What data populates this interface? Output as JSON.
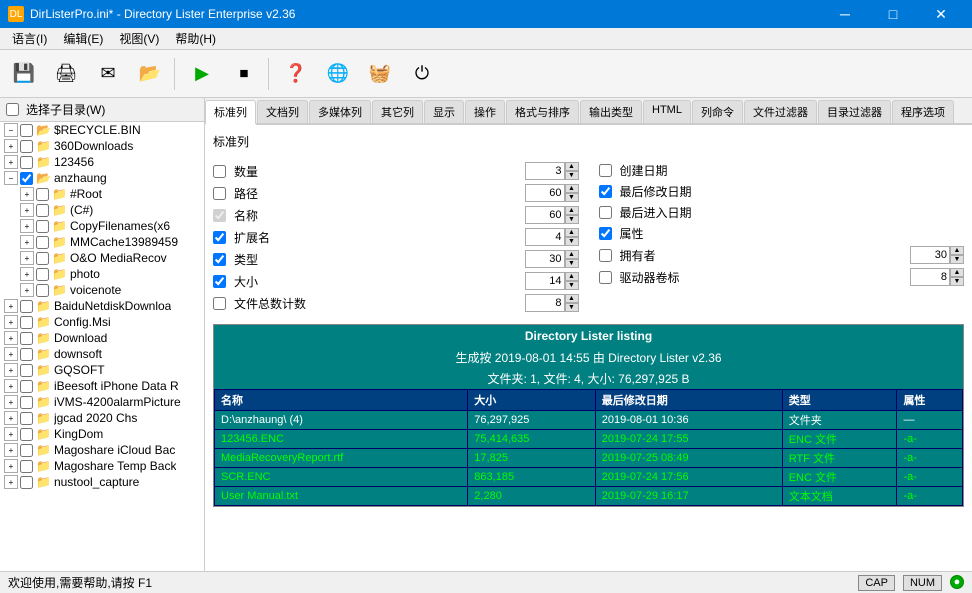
{
  "titleBar": {
    "title": "DirListerPro.ini* - Directory Lister Enterprise v2.36",
    "icon": "DL",
    "minBtn": "─",
    "maxBtn": "□",
    "closeBtn": "✕"
  },
  "menuBar": {
    "items": [
      "语言(I)",
      "编辑(E)",
      "视图(V)",
      "帮助(H)"
    ]
  },
  "toolbar": {
    "buttons": [
      "💾",
      "🖨",
      "✉",
      "📂",
      "▶",
      "⏹",
      "❓",
      "🌐",
      "🧺",
      "⏻"
    ]
  },
  "leftPanel": {
    "header": "选择子目录(W)",
    "treeItems": [
      {
        "id": "recycle",
        "label": "$RECYCLE.BIN",
        "level": 1,
        "expanded": true,
        "checked": false
      },
      {
        "id": "360downloads",
        "label": "360Downloads",
        "level": 1,
        "expanded": false,
        "checked": false
      },
      {
        "id": "123456",
        "label": "123456",
        "level": 1,
        "expanded": false,
        "checked": false
      },
      {
        "id": "anzhaung",
        "label": "anzhaung",
        "level": 1,
        "expanded": true,
        "checked": true
      },
      {
        "id": "root",
        "label": "#Root",
        "level": 2,
        "expanded": false,
        "checked": false
      },
      {
        "id": "csharp",
        "label": "(C#)",
        "level": 2,
        "expanded": false,
        "checked": false
      },
      {
        "id": "copyfilenames",
        "label": "CopyFilenames(x6",
        "level": 2,
        "expanded": false,
        "checked": false
      },
      {
        "id": "mmcache",
        "label": "MMCache13989459",
        "level": 2,
        "expanded": false,
        "checked": false
      },
      {
        "id": "oomedia",
        "label": "O&O MediaRecov",
        "level": 2,
        "expanded": false,
        "checked": false
      },
      {
        "id": "photo",
        "label": "photo",
        "level": 2,
        "expanded": false,
        "checked": false
      },
      {
        "id": "voicenote",
        "label": "voicenote",
        "level": 2,
        "expanded": false,
        "checked": false
      },
      {
        "id": "baidunetdisk",
        "label": "BaiduNetdiskDownloa",
        "level": 1,
        "expanded": false,
        "checked": false
      },
      {
        "id": "configmsi",
        "label": "Config.Msi",
        "level": 1,
        "expanded": false,
        "checked": false
      },
      {
        "id": "download",
        "label": "Download",
        "level": 1,
        "expanded": false,
        "checked": false
      },
      {
        "id": "downsoft",
        "label": "downsoft",
        "level": 1,
        "expanded": false,
        "checked": false
      },
      {
        "id": "gqsoft",
        "label": "GQSOFT",
        "level": 1,
        "expanded": false,
        "checked": false
      },
      {
        "id": "ibeesoft",
        "label": "iBeesoft iPhone Data R",
        "level": 1,
        "expanded": false,
        "checked": false
      },
      {
        "id": "ivms",
        "label": "iVMS-4200alarmPicture",
        "level": 1,
        "expanded": false,
        "checked": false
      },
      {
        "id": "jgcad",
        "label": "jgcad 2020 Chs",
        "level": 1,
        "expanded": false,
        "checked": false
      },
      {
        "id": "kingdom",
        "label": "KingDom",
        "level": 1,
        "expanded": false,
        "checked": false
      },
      {
        "id": "magoshare-icloud",
        "label": "Magoshare iCloud Bac",
        "level": 1,
        "expanded": false,
        "checked": false
      },
      {
        "id": "magoshare-temp",
        "label": "Magoshare Temp Back",
        "level": 1,
        "expanded": false,
        "checked": false
      },
      {
        "id": "nustool",
        "label": "nustool_capture",
        "level": 1,
        "expanded": false,
        "checked": false
      }
    ]
  },
  "tabs": [
    {
      "id": "biaozhunlie",
      "label": "标准列",
      "active": true
    },
    {
      "id": "wendangjie",
      "label": "文档列"
    },
    {
      "id": "duomeitijie",
      "label": "多媒体列"
    },
    {
      "id": "qitajie",
      "label": "其它列"
    },
    {
      "id": "xianshi",
      "label": "显示"
    },
    {
      "id": "caozuo",
      "label": "操作"
    },
    {
      "id": "geshipaipai",
      "label": "格式与排序"
    },
    {
      "id": "shuchuleixing",
      "label": "输出类型"
    },
    {
      "id": "html",
      "label": "HTML"
    },
    {
      "id": "lieming",
      "label": "列命令"
    },
    {
      "id": "wenjianglvbo",
      "label": "文件过滤器"
    },
    {
      "id": "muluglvbo",
      "label": "目录过滤器"
    },
    {
      "id": "chengxuxuanz",
      "label": "程序选项"
    }
  ],
  "standardColumns": {
    "sectionTitle": "标准列",
    "leftColumns": [
      {
        "id": "shuliang",
        "label": "数量",
        "checked": false,
        "hasNum": true,
        "num": "3"
      },
      {
        "id": "lujing",
        "label": "路径",
        "checked": false,
        "hasNum": true,
        "num": "60"
      },
      {
        "id": "mingcheng",
        "label": "名称",
        "checked": true,
        "disabled": true,
        "hasNum": true,
        "num": "60"
      },
      {
        "id": "kuozhanming",
        "label": "扩展名",
        "checked": true,
        "hasNum": true,
        "num": "4"
      },
      {
        "id": "leixing",
        "label": "类型",
        "checked": true,
        "hasNum": true,
        "num": "30"
      },
      {
        "id": "daxiao",
        "label": "大小",
        "checked": true,
        "hasNum": true,
        "num": "14"
      },
      {
        "id": "wenjianzongshu",
        "label": "文件总数计数",
        "checked": false,
        "hasNum": true,
        "num": "8"
      }
    ],
    "rightColumns": [
      {
        "id": "chuangjianriqi",
        "label": "创建日期",
        "checked": false,
        "hasNum": false
      },
      {
        "id": "zuihouXiugai",
        "label": "最后修改日期",
        "checked": true,
        "hasNum": false
      },
      {
        "id": "zuihouJinru",
        "label": "最后进入日期",
        "checked": false,
        "hasNum": false
      },
      {
        "id": "shuxing",
        "label": "属性",
        "checked": true,
        "hasNum": false
      },
      {
        "id": "yongyouzhe",
        "label": "拥有者",
        "checked": false,
        "hasNum": true,
        "num": "30"
      },
      {
        "id": "qudongqijuanb",
        "label": "驱动器卷标",
        "checked": false,
        "hasNum": true,
        "num": "8"
      }
    ]
  },
  "preview": {
    "title": "Directory Lister listing",
    "subtitle1": "生成按 2019-08-01 14:55 由 Directory Lister v2.36",
    "subtitle2": "文件夹: 1, 文件: 4, 大小: 76,297,925 B",
    "tableHeaders": [
      "名称",
      "大小",
      "最后修改日期",
      "类型",
      "属性"
    ],
    "tableRows": [
      {
        "name": "D:\\anzhaung\\ (4)",
        "size": "76,297,925",
        "date": "2019-08-01 10:36",
        "type": "文件夹",
        "attr": "—",
        "isFolder": true
      },
      {
        "name": "123456.ENC",
        "size": "75,414,635",
        "date": "2019-07-24 17:55",
        "type": "ENC 文件",
        "attr": "-a-"
      },
      {
        "name": "MediaRecoveryReport.rtf",
        "size": "17,825",
        "date": "2019-07-25 08:49",
        "type": "RTF 文件",
        "attr": "-a-"
      },
      {
        "name": "SCR.ENC",
        "size": "863,185",
        "date": "2019-07-24 17:56",
        "type": "ENC 文件",
        "attr": "-a-"
      },
      {
        "name": "User Manual.txt",
        "size": "2,280",
        "date": "2019-07-29 16:17",
        "type": "文本文档",
        "attr": "-a-"
      }
    ]
  },
  "statusBar": {
    "text": "欢迎使用,需要帮助,请按 F1",
    "caps": "CAP",
    "num": "NUM"
  }
}
